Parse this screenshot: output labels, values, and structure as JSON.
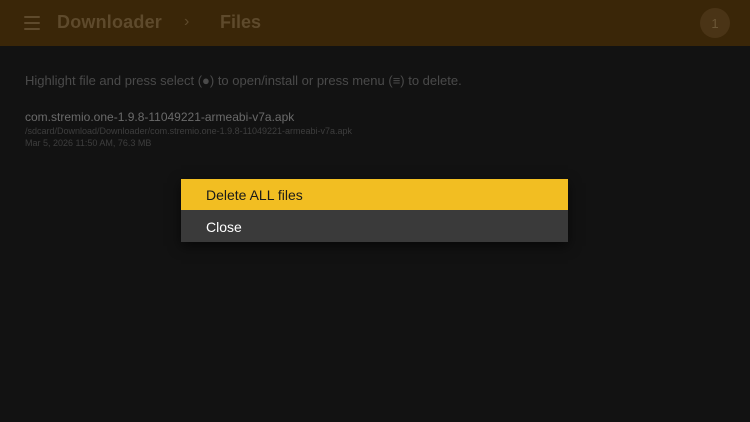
{
  "header": {
    "app_title": "Downloader",
    "separator": "›",
    "section_title": "Files",
    "badge": "1"
  },
  "instructions": "Highlight file and press select (●) to open/install or press menu (≡) to delete.",
  "files": [
    {
      "name": "com.stremio.one-1.9.8-11049221-armeabi-v7a.apk",
      "path": "/sdcard/Download/Downloader/com.stremio.one-1.9.8-11049221-armeabi-v7a.apk",
      "meta": "Mar 5, 2026 11:50 AM, 76.3 MB"
    }
  ],
  "dialog": {
    "items": [
      {
        "label": "Delete ALL files"
      },
      {
        "label": "Close"
      }
    ]
  },
  "colors": {
    "highlight": "#f2be22",
    "topbar": "#3a2608",
    "dialog_bg": "#3a3a3a"
  }
}
